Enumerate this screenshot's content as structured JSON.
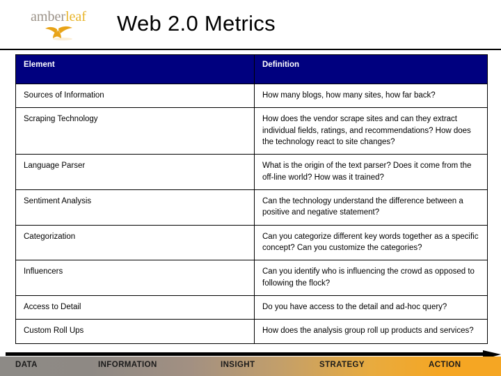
{
  "header": {
    "logo": {
      "word_part_1": "amber",
      "word_part_2": "leaf",
      "color_part_1": "#9b9288",
      "color_part_2": "#e8b428",
      "mark_color": "#e8a317"
    },
    "title": "Web 2.0 Metrics"
  },
  "table": {
    "header_bg": "#00007F",
    "header_text_color": "#FFFFFF",
    "columns": [
      "Element",
      "Definition"
    ],
    "rows": [
      {
        "element": "Sources of Information",
        "definition": "How many blogs, how many sites, how far back?"
      },
      {
        "element": "Scraping Technology",
        "definition": "How does the vendor scrape sites and can they extract individual fields, ratings, and recommendations?  How does the technology react to site changes?"
      },
      {
        "element": "Language Parser",
        "definition": "What is the origin of the text parser?  Does it come from the off-line world?  How was it trained?"
      },
      {
        "element": "Sentiment Analysis",
        "definition": "Can the technology understand the difference between a positive and negative statement?"
      },
      {
        "element": "Categorization",
        "definition": "Can you categorize different key words together as a specific concept?  Can you customize the categories?"
      },
      {
        "element": "Influencers",
        "definition": "Can you identify who is influencing the crowd as opposed to following the flock?"
      },
      {
        "element": "Access to Detail",
        "definition": "Do you have access to the detail and ad-hoc query?"
      },
      {
        "element": "Custom Roll Ups",
        "definition": "How does the analysis group roll up products and services?"
      }
    ]
  },
  "footer": {
    "stages": [
      "DATA",
      "INFORMATION",
      "INSIGHT",
      "STRATEGY",
      "ACTION"
    ],
    "gradient_start": "#8d8a86",
    "gradient_end": "#f5a623",
    "arrow_color": "#000000"
  }
}
